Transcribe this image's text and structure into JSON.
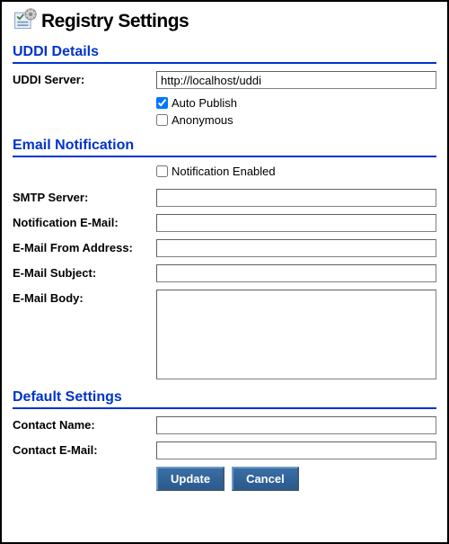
{
  "header": {
    "title": "Registry Settings"
  },
  "uddi": {
    "section_title": "UDDI Details",
    "server_label": "UDDI Server:",
    "server_value": "http://localhost/uddi",
    "auto_publish_label": "Auto Publish",
    "auto_publish_checked": true,
    "anonymous_label": "Anonymous",
    "anonymous_checked": false
  },
  "email": {
    "section_title": "Email Notification",
    "enabled_label": "Notification Enabled",
    "enabled_checked": false,
    "smtp_label": "SMTP Server:",
    "smtp_value": "",
    "notify_label": "Notification E-Mail:",
    "notify_value": "",
    "from_label": "E-Mail From Address:",
    "from_value": "",
    "subject_label": "E-Mail Subject:",
    "subject_value": "",
    "body_label": "E-Mail Body:",
    "body_value": ""
  },
  "defaults": {
    "section_title": "Default Settings",
    "contact_name_label": "Contact Name:",
    "contact_name_value": "",
    "contact_email_label": "Contact E-Mail:",
    "contact_email_value": ""
  },
  "buttons": {
    "update": "Update",
    "cancel": "Cancel"
  }
}
